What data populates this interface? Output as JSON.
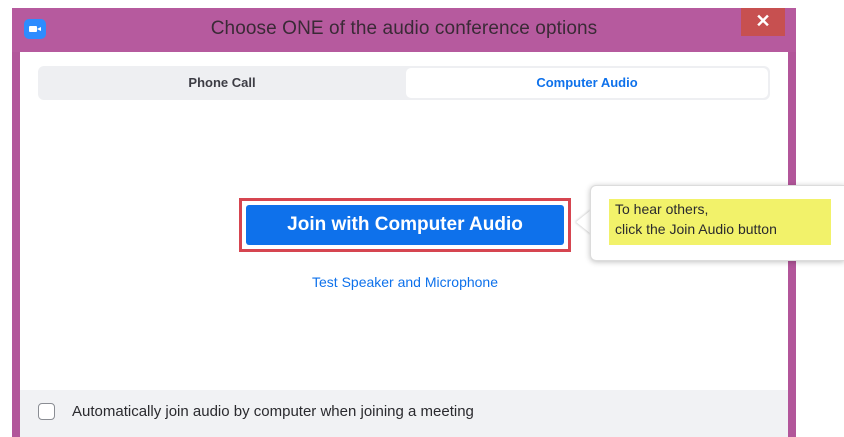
{
  "window": {
    "title": "Choose ONE of the audio conference options",
    "app_icon": "zoom-video-icon",
    "close_label": "✕",
    "frame_color": "#b2569a"
  },
  "tabs": [
    {
      "label": "Phone Call",
      "selected": false
    },
    {
      "label": "Computer Audio",
      "selected": true
    }
  ],
  "main": {
    "join_button_label": "Join with Computer Audio",
    "test_link_label": "Test Speaker and Microphone",
    "accent_color": "#0e71eb",
    "highlight_color": "#d64550"
  },
  "footer": {
    "checkbox_checked": false,
    "checkbox_label": "Automatically join audio by computer when joining a meeting"
  },
  "tooltip": {
    "line1": "To hear others,",
    "line2": "click the Join Audio button",
    "highlight_color": "#f2f26a"
  }
}
